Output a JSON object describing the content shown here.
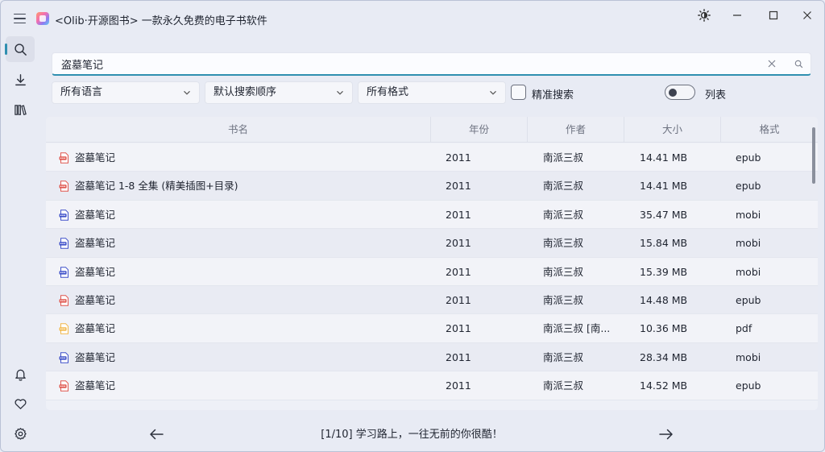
{
  "window": {
    "title": "<Olib·开源图书> 一款永久免费的电子书软件"
  },
  "search": {
    "value": "盗墓笔记"
  },
  "filters": {
    "language": "所有语言",
    "order": "默认搜索顺序",
    "format": "所有格式",
    "exact_label": "精准搜索",
    "exact_checked": false,
    "list_label": "列表",
    "list_on": false
  },
  "table": {
    "headers": {
      "name": "书名",
      "year": "年份",
      "author": "作者",
      "size": "大小",
      "format": "格式"
    },
    "rows": [
      {
        "name": "盗墓笔记",
        "year": "2011",
        "author": "南派三叔",
        "size": "14.41 MB",
        "format": "epub"
      },
      {
        "name": "盗墓笔记 1-8 全集 (精美插图+目录)",
        "year": "2011",
        "author": "南派三叔",
        "size": "14.41 MB",
        "format": "epub"
      },
      {
        "name": "盗墓笔记",
        "year": "2011",
        "author": "南派三叔",
        "size": "35.47 MB",
        "format": "mobi"
      },
      {
        "name": "盗墓笔记",
        "year": "2011",
        "author": "南派三叔",
        "size": "15.84 MB",
        "format": "mobi"
      },
      {
        "name": "盗墓笔记",
        "year": "2011",
        "author": "南派三叔",
        "size": "15.39 MB",
        "format": "mobi"
      },
      {
        "name": "盗墓笔记",
        "year": "2011",
        "author": "南派三叔",
        "size": "14.48 MB",
        "format": "epub"
      },
      {
        "name": "盗墓笔记",
        "year": "2011",
        "author": "南派三叔 [南...",
        "size": "10.36 MB",
        "format": "pdf"
      },
      {
        "name": "盗墓笔记",
        "year": "2011",
        "author": "南派三叔",
        "size": "28.34 MB",
        "format": "mobi"
      },
      {
        "name": "盗墓笔记",
        "year": "2011",
        "author": "南派三叔",
        "size": "14.52 MB",
        "format": "epub"
      }
    ]
  },
  "footer": {
    "page_info": "[1/10] 学习路上，一往无前的你很酷！"
  },
  "colors": {
    "accent": "#2f8fb0",
    "epub_icon": "#e0574f",
    "mobi_icon": "#3f51c9",
    "pdf_icon": "#f2b84b"
  }
}
